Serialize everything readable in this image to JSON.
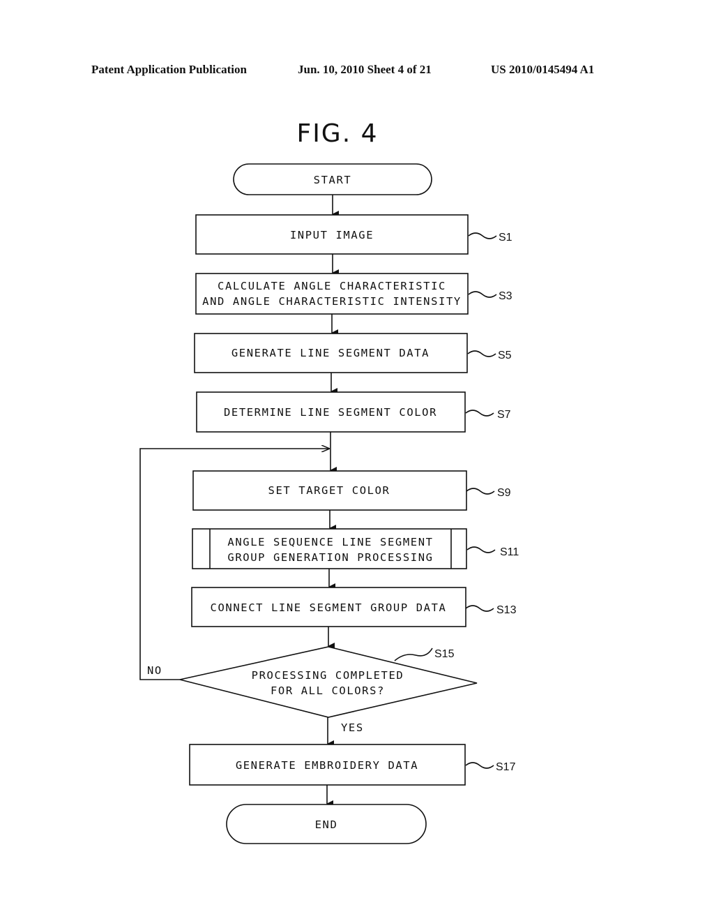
{
  "header": {
    "publication": "Patent Application Publication",
    "date_sheet": "Jun. 10, 2010  Sheet 4 of 21",
    "patent_number": "US 2010/0145494 A1"
  },
  "figure": {
    "title": "FIG. 4"
  },
  "flow": {
    "start": "START",
    "end": "END",
    "steps": [
      {
        "id": "S1",
        "lines": [
          "INPUT IMAGE"
        ]
      },
      {
        "id": "S3",
        "lines": [
          "CALCULATE ANGLE CHARACTERISTIC",
          "AND ANGLE CHARACTERISTIC INTENSITY"
        ]
      },
      {
        "id": "S5",
        "lines": [
          "GENERATE LINE SEGMENT DATA"
        ]
      },
      {
        "id": "S7",
        "lines": [
          "DETERMINE LINE SEGMENT COLOR"
        ]
      },
      {
        "id": "S9",
        "lines": [
          "SET TARGET COLOR"
        ]
      },
      {
        "id": "S11",
        "lines": [
          "ANGLE SEQUENCE LINE SEGMENT",
          "GROUP GENERATION PROCESSING"
        ],
        "type": "subprocess"
      },
      {
        "id": "S13",
        "lines": [
          "CONNECT LINE SEGMENT GROUP DATA"
        ]
      },
      {
        "id": "S15",
        "lines": [
          "PROCESSING COMPLETED",
          "FOR ALL COLORS?"
        ],
        "type": "decision"
      },
      {
        "id": "S17",
        "lines": [
          "GENERATE EMBROIDERY DATA"
        ]
      }
    ],
    "branch_no": "NO",
    "branch_yes": "YES"
  }
}
